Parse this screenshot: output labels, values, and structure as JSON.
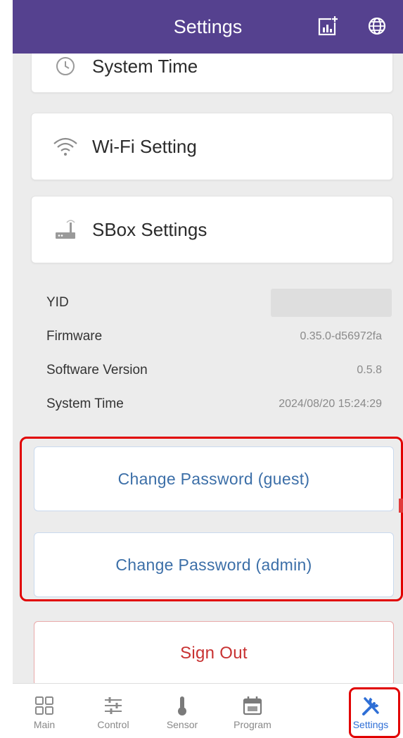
{
  "header": {
    "title": "Settings"
  },
  "cards": {
    "system_time": "System Time",
    "wifi": "Wi-Fi Setting",
    "sbox": "SBox Settings"
  },
  "info": {
    "yid_label": "YID",
    "yid_value": "",
    "firmware_label": "Firmware",
    "firmware_value": "0.35.0-d56972fa",
    "software_label": "Software Version",
    "software_value": "0.5.8",
    "systime_label": "System Time",
    "systime_value": "2024/08/20 15:24:29"
  },
  "buttons": {
    "change_guest": "Change Password (guest)",
    "change_admin": "Change Password (admin)",
    "sign_out": "Sign Out"
  },
  "nav": {
    "items": [
      {
        "label": "Main",
        "icon": "grid-icon"
      },
      {
        "label": "Control",
        "icon": "sliders-icon"
      },
      {
        "label": "Sensor",
        "icon": "thermometer-icon"
      },
      {
        "label": "Program",
        "icon": "calendar-icon"
      },
      {
        "label": "Settings",
        "icon": "tools-icon",
        "active": true
      }
    ]
  },
  "colors": {
    "header_bg": "#55418f",
    "accent_link": "#3c6fa8",
    "danger": "#c83232",
    "active_nav": "#2f6fd6",
    "highlight": "#e10000"
  }
}
